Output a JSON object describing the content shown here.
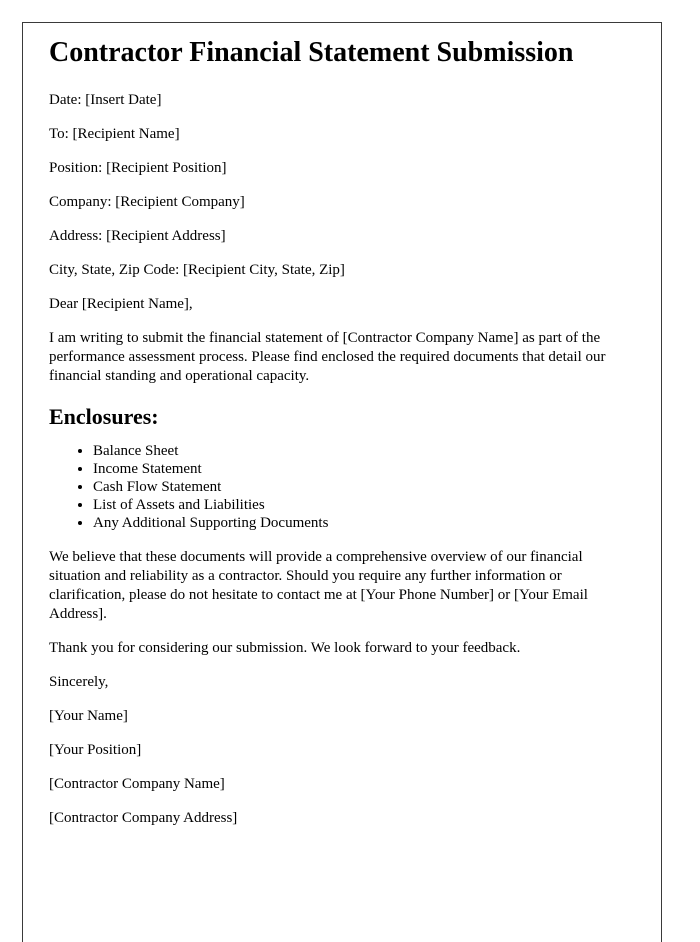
{
  "document": {
    "title": "Contractor Financial Statement Submission",
    "header_fields": [
      {
        "label": "Date:",
        "value": "[Insert Date]",
        "full": "Date: [Insert Date]"
      },
      {
        "label": "To:",
        "value": "[Recipient Name]",
        "full": "To: [Recipient Name]"
      },
      {
        "label": "Position:",
        "value": "[Recipient Position]",
        "full": "Position: [Recipient Position]"
      },
      {
        "label": "Company:",
        "value": "[Recipient Company]",
        "full": "Company: [Recipient Company]"
      },
      {
        "label": "Address:",
        "value": "[Recipient Address]",
        "full": "Address: [Recipient Address]"
      },
      {
        "label": "City, State, Zip Code:",
        "value": "[Recipient City, State, Zip]",
        "full": "City, State, Zip Code: [Recipient City, State, Zip]"
      }
    ],
    "salutation": "Dear [Recipient Name],",
    "opening_paragraph": "I am writing to submit the financial statement of [Contractor Company Name] as part of the performance assessment process. Please find enclosed the required documents that detail our financial standing and operational capacity.",
    "enclosures_heading": "Enclosures:",
    "enclosures": [
      "Balance Sheet",
      "Income Statement",
      "Cash Flow Statement",
      "List of Assets and Liabilities",
      "Any Additional Supporting Documents"
    ],
    "closing_paragraph": "We believe that these documents will provide a comprehensive overview of our financial situation and reliability as a contractor. Should you require any further information or clarification, please do not hesitate to contact me at [Your Phone Number] or [Your Email Address].",
    "thanks_paragraph": "Thank you for considering our submission. We look forward to your feedback.",
    "signoff": "Sincerely,",
    "signature_block": [
      "[Your Name]",
      "[Your Position]",
      "[Contractor Company Name]",
      "[Contractor Company Address]"
    ]
  },
  "style": {
    "page_background": "#ffffff",
    "text_color": "#000000",
    "border_color": "#3a3a3a"
  }
}
